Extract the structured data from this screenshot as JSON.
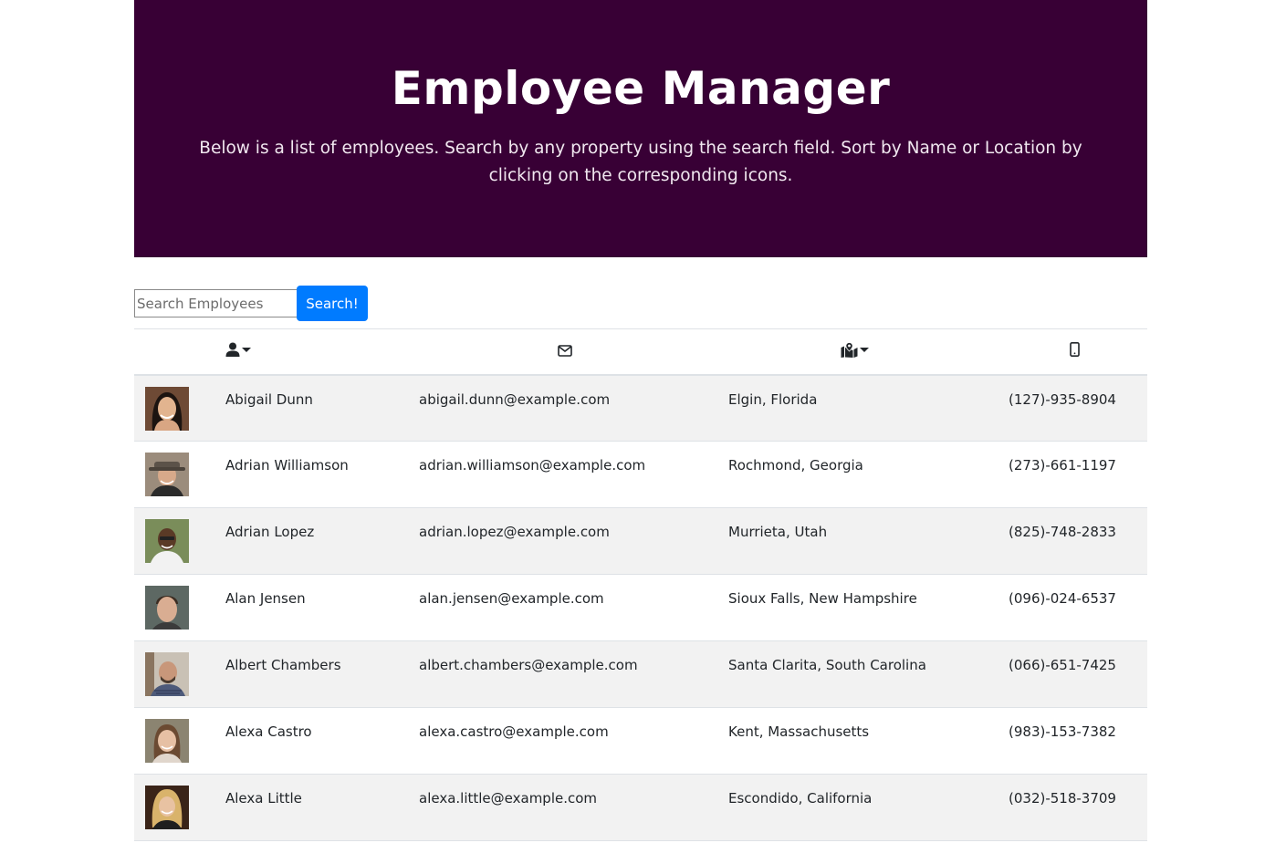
{
  "header": {
    "title": "Employee Manager",
    "subtitle": "Below is a list of employees. Search by any property using the search field. Sort by Name or Location by clicking on the corresponding icons."
  },
  "search": {
    "placeholder": "Search Employees",
    "value": "",
    "button_label": "Search!"
  },
  "columns": [
    {
      "icon": "user-icon",
      "sortable": true
    },
    {
      "icon": "envelope-icon",
      "sortable": false
    },
    {
      "icon": "map-marker-icon",
      "sortable": true
    },
    {
      "icon": "mobile-phone-icon",
      "sortable": false
    }
  ],
  "employees": [
    {
      "name": "Abigail Dunn",
      "email": "abigail.dunn@example.com",
      "location": "Elgin, Florida",
      "phone": "(127)-935-8904"
    },
    {
      "name": "Adrian Williamson",
      "email": "adrian.williamson@example.com",
      "location": "Rochmond, Georgia",
      "phone": "(273)-661-1197"
    },
    {
      "name": "Adrian Lopez",
      "email": "adrian.lopez@example.com",
      "location": "Murrieta, Utah",
      "phone": "(825)-748-2833"
    },
    {
      "name": "Alan Jensen",
      "email": "alan.jensen@example.com",
      "location": "Sioux Falls, New Hampshire",
      "phone": "(096)-024-6537"
    },
    {
      "name": "Albert Chambers",
      "email": "albert.chambers@example.com",
      "location": "Santa Clarita, South Carolina",
      "phone": "(066)-651-7425"
    },
    {
      "name": "Alexa Castro",
      "email": "alexa.castro@example.com",
      "location": "Kent, Massachusetts",
      "phone": "(983)-153-7382"
    },
    {
      "name": "Alexa Little",
      "email": "alexa.little@example.com",
      "location": "Escondido, California",
      "phone": "(032)-518-3709"
    }
  ],
  "colors": {
    "header_bg": "#380035",
    "button_bg": "#007bff",
    "stripe_bg": "#f2f2f2"
  }
}
